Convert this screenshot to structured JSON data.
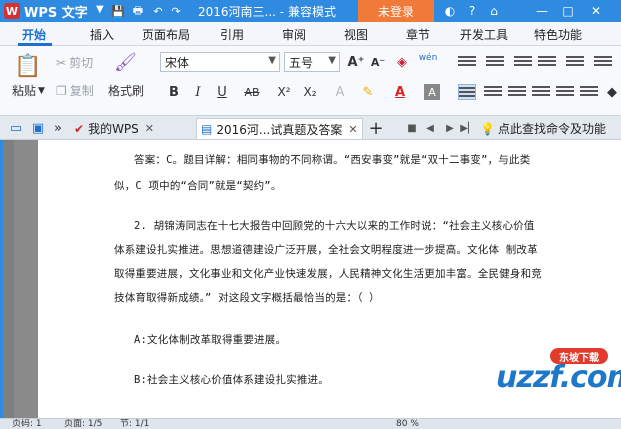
{
  "titlebar": {
    "app_name": "WPS 文字",
    "doc_title": "2016河南三... - 兼容模式",
    "login_label": "未登录",
    "bg_color": "#2f8be0",
    "accent_color": "#f07a3a"
  },
  "ribbon_tabs": [
    {
      "label": "开始"
    },
    {
      "label": "插入"
    },
    {
      "label": "页面布局"
    },
    {
      "label": "引用"
    },
    {
      "label": "审阅"
    },
    {
      "label": "视图"
    },
    {
      "label": "章节"
    },
    {
      "label": "开发工具"
    },
    {
      "label": "特色功能"
    }
  ],
  "ribbon": {
    "paste_label": "粘贴",
    "cut_label": "剪切",
    "copy_label": "复制",
    "format_painter_label": "格式刷",
    "font_name": "宋体",
    "font_size": "五号",
    "bold": "B",
    "italic": "I",
    "underline": "U",
    "strikethrough": "AB",
    "superscript": "X²",
    "subscript": "X₂",
    "grow_font": "A⁺",
    "shrink_font": "A⁻",
    "wen_label": "wén"
  },
  "doc_tabs": {
    "my_wps": "我的WPS",
    "active_doc": "2016河...试真题及答案",
    "search_hint": "点此查找命令及功能"
  },
  "document": {
    "lines": [
      "答案：C。题目详解：相同事物的不同称谓。“西安事变”就是“双十二事变”，与此类",
      "似，C 项中的“合同”就是“契约”。",
      "2. 胡锦涛同志在十七大报告中回顾党的十六大以来的工作时说：“社会主义核心价值",
      "体系建设扎实推进。思想道德建设广泛开展，全社会文明程度进一步提高。文化体 制改革",
      "取得重要进展，文化事业和文化产业快速发展，人民精神文化生活更加丰富。全民健身和竞",
      "技体育取得新成绩。” 对这段文字概括最恰当的是：（ ）",
      "A:文化体制改革取得重要进展。",
      "B:社会主义核心价值体系建设扎实推进。"
    ]
  },
  "statusbar": {
    "page_label": "页码: 1",
    "pages_label": "页面: 1/5",
    "section_label": "节: 1/1",
    "zoom": "80 %"
  },
  "watermark": {
    "brand": "uzzf.com",
    "badge": "东坡下载"
  }
}
